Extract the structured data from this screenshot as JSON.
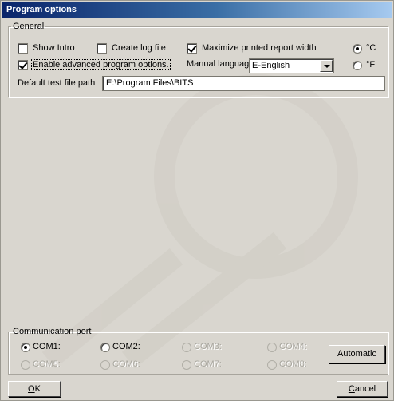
{
  "window": {
    "title": "Program options"
  },
  "general": {
    "legend": "General",
    "show_intro": {
      "label": "Show Intro",
      "checked": false
    },
    "create_log": {
      "label": "Create log file",
      "checked": false
    },
    "maximize_width": {
      "label": "Maximize printed report width",
      "checked": true
    },
    "advanced": {
      "label": "Enable advanced program options.",
      "checked": true
    },
    "manual_language": {
      "label": "Manual language",
      "value": "E-English"
    },
    "units": [
      {
        "label": "°C",
        "selected": true
      },
      {
        "label": "°F",
        "selected": false
      }
    ],
    "test_path": {
      "label": "Default test file path",
      "value": "E:\\Program Files\\BITS"
    }
  },
  "comm": {
    "legend": "Communication port",
    "ports": [
      {
        "label": "COM1:",
        "selected": true,
        "enabled": true
      },
      {
        "label": "COM2:",
        "selected": false,
        "enabled": true
      },
      {
        "label": "COM3:",
        "selected": false,
        "enabled": false
      },
      {
        "label": "COM4:",
        "selected": false,
        "enabled": false
      },
      {
        "label": "COM5:",
        "selected": false,
        "enabled": false
      },
      {
        "label": "COM6:",
        "selected": false,
        "enabled": false
      },
      {
        "label": "COM7:",
        "selected": false,
        "enabled": false
      },
      {
        "label": "COM8:",
        "selected": false,
        "enabled": false
      }
    ],
    "automatic_label": "Automatic"
  },
  "footer": {
    "ok": {
      "mnemonic": "O",
      "rest": "K"
    },
    "cancel": {
      "mnemonic": "C",
      "rest": "ancel"
    }
  },
  "colors": {
    "dialog_bg": "#d9d6cf",
    "title_start": "#0a246a",
    "title_end": "#a6caf0"
  }
}
